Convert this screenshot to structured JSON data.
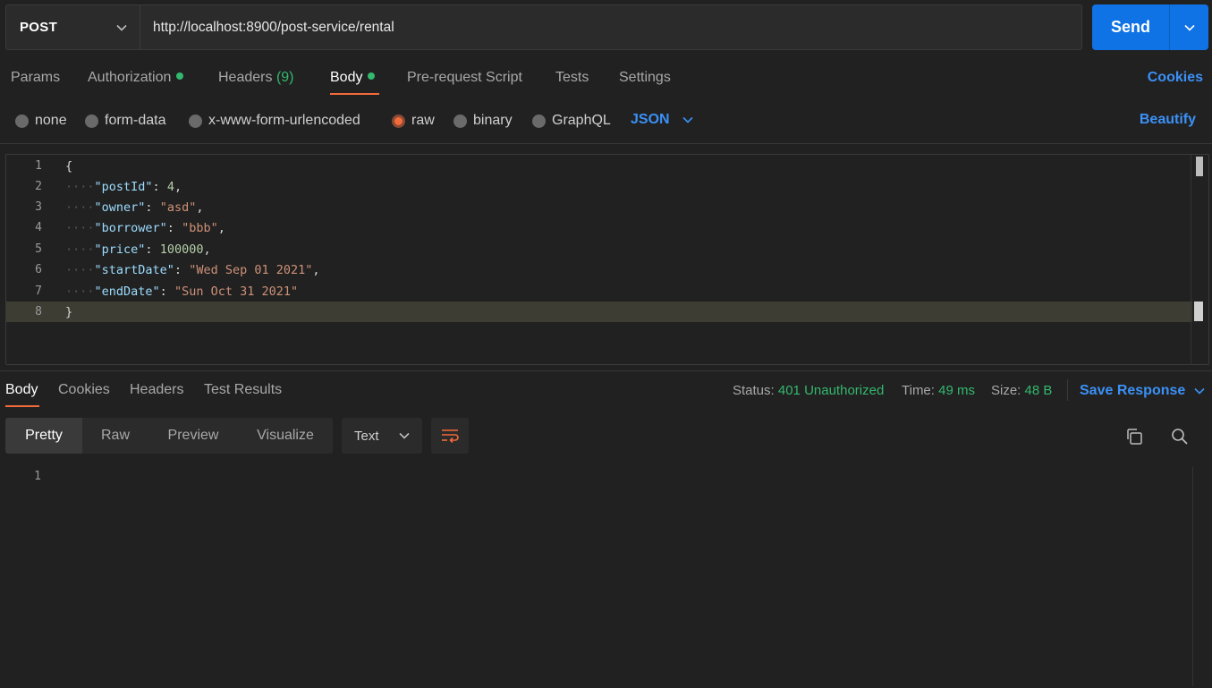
{
  "request": {
    "method": "POST",
    "url": "http://localhost:8900/post-service/rental",
    "send_label": "Send"
  },
  "request_tabs": {
    "params": "Params",
    "authorization": "Authorization",
    "headers": "Headers",
    "headers_count": "(9)",
    "body": "Body",
    "prerequest": "Pre-request Script",
    "tests": "Tests",
    "settings": "Settings",
    "cookies": "Cookies"
  },
  "body_types": {
    "none": "none",
    "form_data": "form-data",
    "urlencoded": "x-www-form-urlencoded",
    "raw": "raw",
    "binary": "binary",
    "graphql": "GraphQL",
    "language": "JSON",
    "beautify": "Beautify"
  },
  "editor": {
    "line_numbers": [
      "1",
      "2",
      "3",
      "4",
      "5",
      "6",
      "7",
      "8"
    ],
    "open_brace": "{",
    "close_brace": "}",
    "fields": [
      {
        "key": "\"postId\"",
        "value": "4",
        "trail": ","
      },
      {
        "key": "\"owner\"",
        "value": "\"asd\"",
        "trail": ","
      },
      {
        "key": "\"borrower\"",
        "value": "\"bbb\"",
        "trail": ","
      },
      {
        "key": "\"price\"",
        "value": "100000",
        "trail": ","
      },
      {
        "key": "\"startDate\"",
        "value": "\"Wed Sep 01 2021\"",
        "trail": ","
      },
      {
        "key": "\"endDate\"",
        "value": "\"Sun Oct 31 2021\"",
        "trail": ""
      }
    ]
  },
  "response": {
    "tabs": {
      "body": "Body",
      "cookies": "Cookies",
      "headers": "Headers",
      "test_results": "Test Results"
    },
    "status_label": "Status:",
    "status_value": "401 Unauthorized",
    "time_label": "Time:",
    "time_value": "49 ms",
    "size_label": "Size:",
    "size_value": "48 B",
    "save_response": "Save Response",
    "views": {
      "pretty": "Pretty",
      "raw": "Raw",
      "preview": "Preview",
      "visualize": "Visualize"
    },
    "format": "Text",
    "line_number": "1"
  },
  "colors": {
    "accent_orange": "#f26b3a",
    "link_blue": "#3b91f7",
    "send_blue": "#0f72e5",
    "success_green": "#33b86e",
    "background": "#212121"
  }
}
